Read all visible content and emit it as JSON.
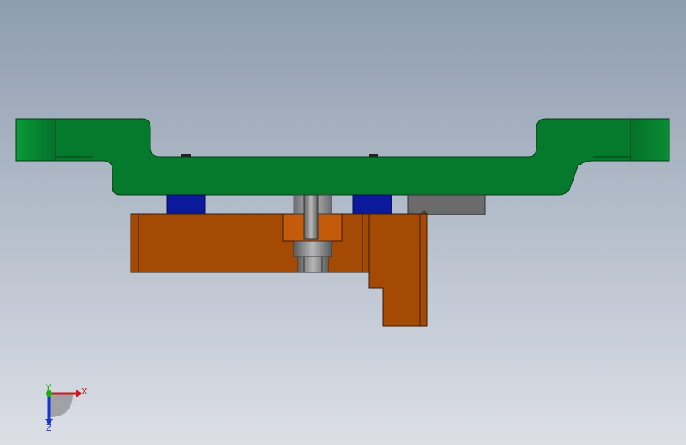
{
  "viewport": {
    "background_top": "#8e9db0",
    "background_bottom": "#dcdfe6"
  },
  "triad": {
    "x_label": "X",
    "y_label": "Y",
    "z_label": "Z",
    "x_color": "#d01818",
    "y_color": "#18b018",
    "z_color": "#1830d0"
  },
  "parts": {
    "plate_color": "#067a2c",
    "plate_dark": "#05571f",
    "block_color": "#a44a04",
    "block_light": "#c45b0a",
    "pad_color": "#0b1a9a",
    "spacer_color": "#6b6b6b",
    "bolt_color": "#8a8a8a"
  }
}
